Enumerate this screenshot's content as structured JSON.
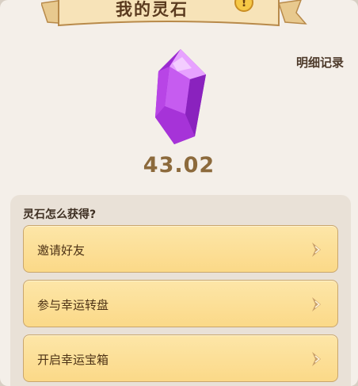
{
  "header": {
    "title": "我的灵石",
    "help_icon": "help-icon",
    "help_glyph": "!"
  },
  "detail_link": "明细记录",
  "balance": "43.02",
  "earn": {
    "title": "灵石怎么获得?",
    "items": [
      {
        "label": "邀请好友"
      },
      {
        "label": "参与幸运转盘"
      },
      {
        "label": "开启幸运宝箱"
      }
    ]
  },
  "colors": {
    "panel_bg": "#f4efe9",
    "balance_text": "#8c6a3c",
    "row_bg": "#fbd988",
    "gem": "#b43ee0"
  }
}
